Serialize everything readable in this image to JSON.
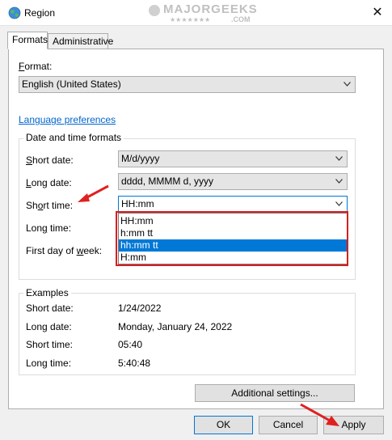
{
  "window": {
    "title": "Region",
    "close_glyph": "✕",
    "icon": "globe-icon"
  },
  "watermark": {
    "text": "MAJORGEEKS",
    "sub": ".COM",
    "stars": "★★★★★★★"
  },
  "tabs": [
    {
      "label": "Formats",
      "active": true
    },
    {
      "label": "Administrative",
      "active": false
    }
  ],
  "format": {
    "label": "Format:",
    "value": "English (United States)"
  },
  "language_link": "Language preferences",
  "datetime": {
    "group_label": "Date and time formats",
    "short_date": {
      "label_u": "S",
      "label_rest": "hort date:",
      "value": "M/d/yyyy"
    },
    "long_date": {
      "label_u": "L",
      "label_rest": "ong date:",
      "value": "dddd, MMMM d, yyyy"
    },
    "short_time": {
      "label_pre": "Sh",
      "label_u": "o",
      "label_rest": "rt time:",
      "value": "HH:mm"
    },
    "long_time": {
      "label_pre": "Lon",
      "label_u": "g",
      "label_rest": " time:"
    },
    "first_day": {
      "label_pre": "First day of ",
      "label_u": "w",
      "label_rest": "eek:"
    }
  },
  "short_time_options": [
    {
      "label": "HH:mm",
      "selected": false
    },
    {
      "label": "h:mm tt",
      "selected": false
    },
    {
      "label": "hh:mm tt",
      "selected": true
    },
    {
      "label": "H:mm",
      "selected": false
    }
  ],
  "examples": {
    "group_label": "Examples",
    "rows": [
      {
        "label": "Short date:",
        "value": "1/24/2022"
      },
      {
        "label": "Long date:",
        "value": "Monday, January 24, 2022"
      },
      {
        "label": "Short time:",
        "value": "05:40"
      },
      {
        "label": "Long time:",
        "value": "5:40:48"
      }
    ]
  },
  "buttons": {
    "additional_pre": "Additional settings...",
    "ok": "OK",
    "cancel": "Cancel",
    "apply": "Apply"
  },
  "colors": {
    "accent": "#0078d7",
    "highlight_box": "#d81e1e",
    "arrow": "#e02020",
    "link": "#0066cc"
  }
}
